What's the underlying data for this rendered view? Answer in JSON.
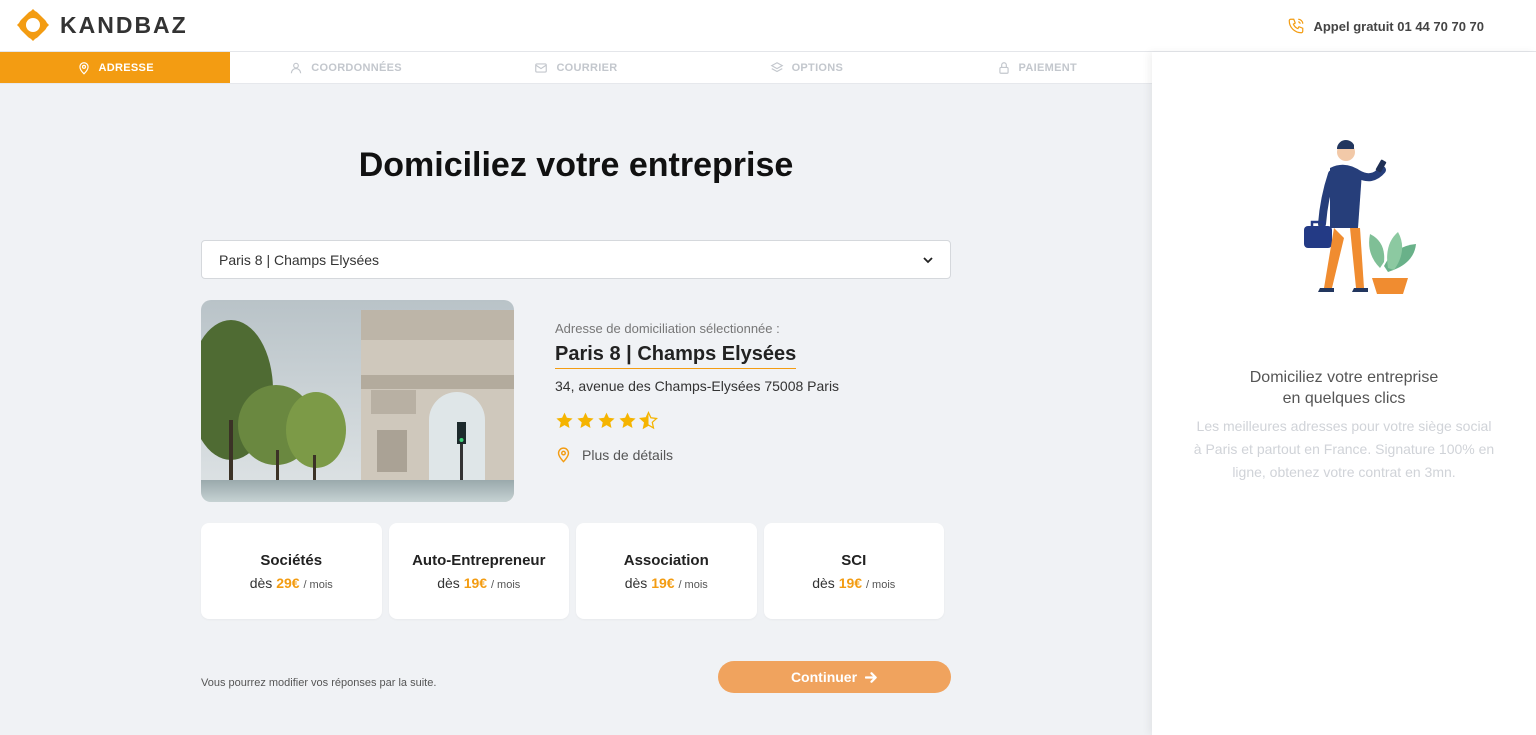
{
  "header": {
    "logo_text": "KANDBAZ",
    "phone_label": "Appel gratuit 01 44 70 70 70"
  },
  "steps": [
    {
      "label": "ADRESSE",
      "icon": "location-pin-icon",
      "active": true
    },
    {
      "label": "COORDONNÉES",
      "icon": "user-icon",
      "active": false
    },
    {
      "label": "COURRIER",
      "icon": "mail-icon",
      "active": false
    },
    {
      "label": "OPTIONS",
      "icon": "layers-icon",
      "active": false
    },
    {
      "label": "PAIEMENT",
      "icon": "lock-icon",
      "active": false
    }
  ],
  "main": {
    "title": "Domiciliez votre entreprise",
    "select_value": "Paris 8 | Champs Elysées",
    "address_caption": "Adresse de domiciliation sélectionnée :",
    "address_name": "Paris 8 | Champs Elysées",
    "address_street": "34, avenue des Champs-Elysées 75008 Paris",
    "rating": 4.5,
    "details_label": "Plus de détails",
    "offers": [
      {
        "name": "Sociétés",
        "prefix": "dès",
        "price": "29€",
        "per": "/ mois"
      },
      {
        "name": "Auto-Entrepreneur",
        "prefix": "dès",
        "price": "19€",
        "per": "/ mois"
      },
      {
        "name": "Association",
        "prefix": "dès",
        "price": "19€",
        "per": "/ mois"
      },
      {
        "name": "SCI",
        "prefix": "dès",
        "price": "19€",
        "per": "/ mois"
      }
    ],
    "note": "Vous pourrez modifier vos réponses par la suite.",
    "continue_label": "Continuer"
  },
  "side": {
    "title_line1": "Domiciliez votre entreprise",
    "title_line2": "en quelques clics",
    "description": "Les meilleures adresses pour votre siège social à Paris et partout en France. Signature 100% en ligne, obtenez votre contrat en 3mn."
  },
  "colors": {
    "accent": "#f39c12",
    "button": "#f0a35e",
    "background": "#f0f2f5",
    "star": "#f5b400"
  }
}
